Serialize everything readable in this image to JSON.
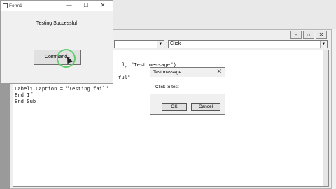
{
  "form1": {
    "title": "Form1",
    "label_text": "Testing Successful",
    "command_label": "Command1",
    "minimize": "—",
    "maximize": "☐",
    "close": "✕"
  },
  "editor": {
    "object_combo": "",
    "proc_combo": "Click",
    "code_lines": [
      "l, \"Test message\")",
      "ful\"",
      "Label1.Caption = \"Testing fail\"",
      "End If",
      "End Sub"
    ]
  },
  "msgbox": {
    "title": "Test message",
    "close": "✕",
    "text": "Click to test",
    "ok": "OK",
    "cancel": "Cancel"
  }
}
